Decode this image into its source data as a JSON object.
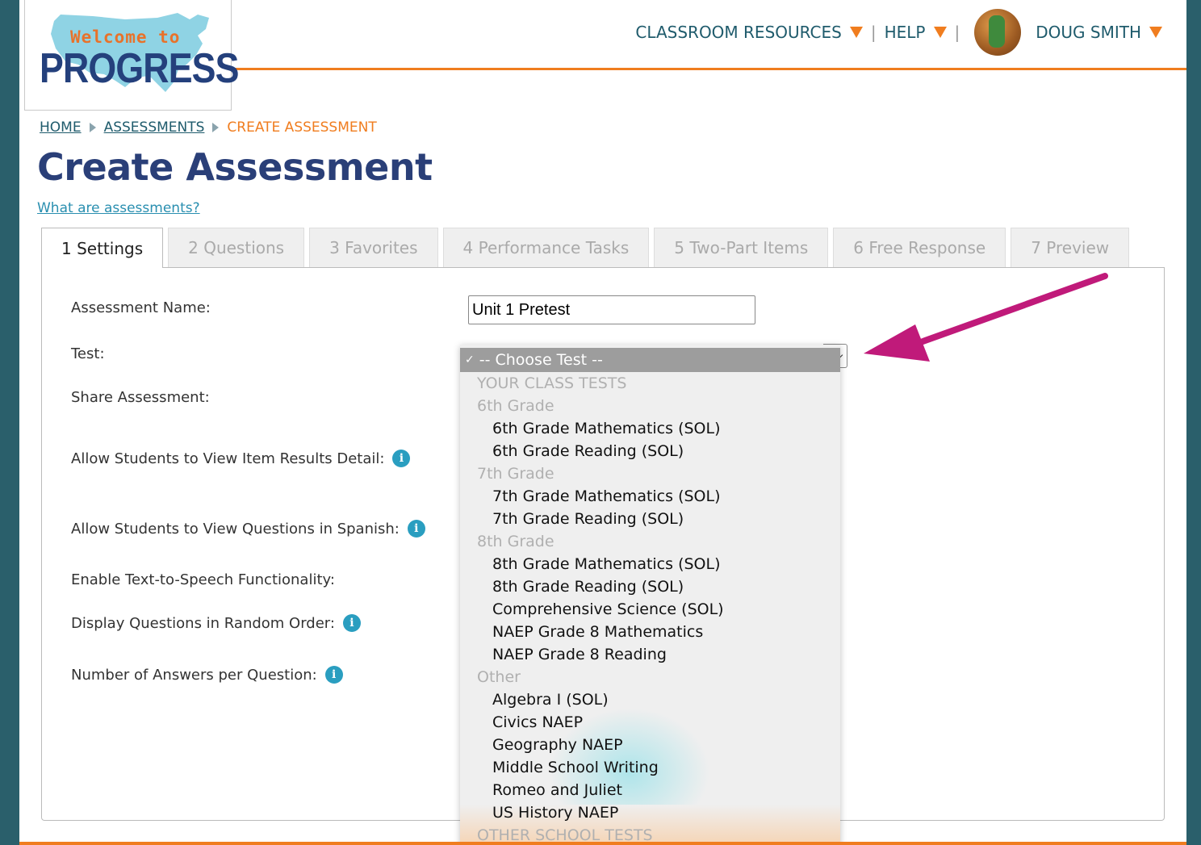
{
  "header": {
    "logo": {
      "line1": "Welcome to",
      "line2": "PROGRESS"
    },
    "nav": {
      "classroom_resources": "CLASSROOM RESOURCES",
      "help": "HELP",
      "separator": "|",
      "user_name": "DOUG SMITH"
    }
  },
  "breadcrumb": {
    "home": "HOME",
    "assessments": "ASSESSMENTS",
    "current": "CREATE ASSESSMENT"
  },
  "page": {
    "title": "Create Assessment",
    "help_link": "What are assessments?"
  },
  "tabs": [
    {
      "label": "1 Settings",
      "active": true
    },
    {
      "label": "2 Questions"
    },
    {
      "label": "3 Favorites"
    },
    {
      "label": "4 Performance Tasks"
    },
    {
      "label": "5 Two-Part Items"
    },
    {
      "label": "6 Free Response"
    },
    {
      "label": "7 Preview"
    }
  ],
  "form": {
    "assessment_name_label": "Assessment Name:",
    "assessment_name_value": "Unit 1 Pretest",
    "test_label": "Test:",
    "share_label": "Share Assessment:",
    "item_results_label": "Allow Students to View Item Results Detail:",
    "spanish_label": "Allow Students to View Questions in Spanish:",
    "tts_label": "Enable Text-to-Speech Functionality:",
    "random_order_label": "Display Questions in Random Order:",
    "answers_per_question_label": "Number of Answers per Question:"
  },
  "dropdown": {
    "check": "✓",
    "selected": "-- Choose Test --",
    "group_your_class_tests": "YOUR CLASS TESTS",
    "group_6": "6th Grade",
    "opt_6_math": "6th Grade Mathematics (SOL)",
    "opt_6_reading": "6th Grade Reading (SOL)",
    "group_7": "7th Grade",
    "opt_7_math": "7th Grade Mathematics (SOL)",
    "opt_7_reading": "7th Grade Reading (SOL)",
    "group_8": "8th Grade",
    "opt_8_math": "8th Grade Mathematics (SOL)",
    "opt_8_reading": "8th Grade Reading (SOL)",
    "opt_comp_science": "Comprehensive Science (SOL)",
    "opt_naep_8_math": "NAEP Grade 8 Mathematics",
    "opt_naep_8_reading": "NAEP Grade 8 Reading",
    "group_other": "Other",
    "opt_algebra": "Algebra I (SOL)",
    "opt_civics": "Civics NAEP",
    "opt_geography": "Geography NAEP",
    "opt_ms_writing": "Middle School Writing",
    "opt_romeo": "Romeo and Juliet",
    "opt_us_history": "US History NAEP",
    "group_other_school_tests": "OTHER SCHOOL TESTS"
  },
  "colors": {
    "accent_orange": "#f07d1f",
    "title_navy": "#2a3f78",
    "teal": "#1f5b6c",
    "info_blue": "#2a9ec0",
    "annotation_magenta": "#c01a7a"
  }
}
